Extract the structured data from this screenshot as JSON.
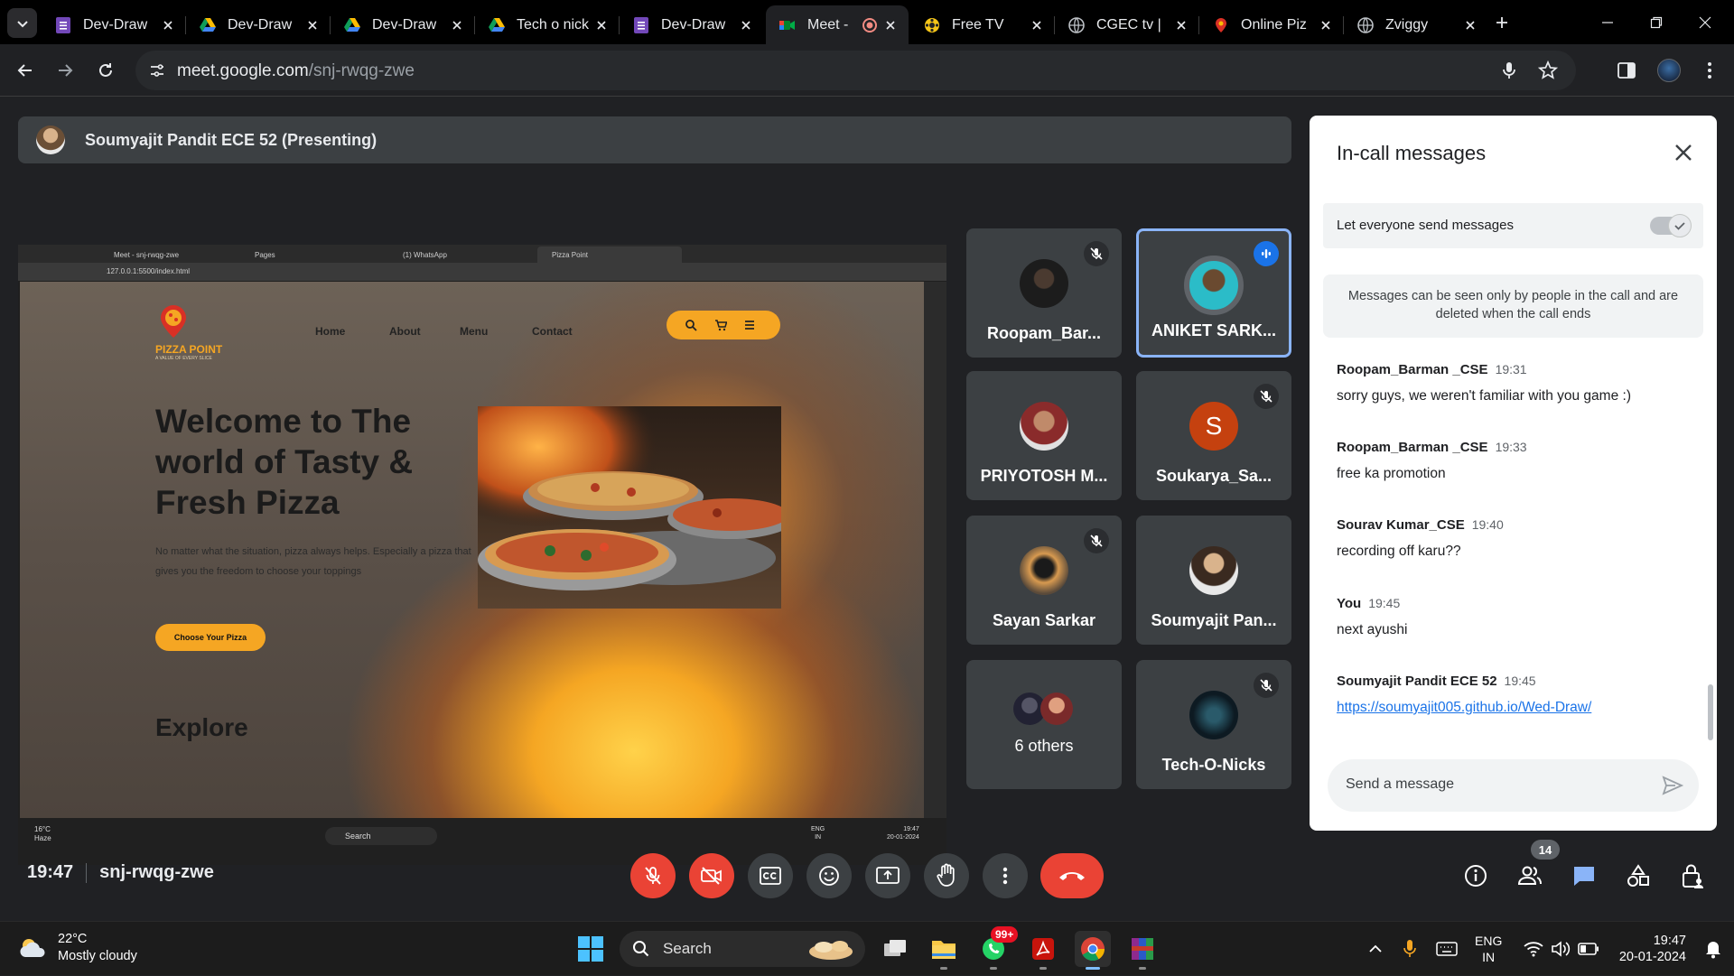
{
  "browser": {
    "tabs": [
      {
        "title": "Dev-Draw",
        "icon": "forms-icon",
        "active": false
      },
      {
        "title": "Dev-Draw",
        "icon": "drive-icon",
        "active": false
      },
      {
        "title": "Dev-Draw",
        "icon": "drive-icon",
        "active": false
      },
      {
        "title": "Tech o nick",
        "icon": "drive-icon",
        "active": false
      },
      {
        "title": "Dev-Draw",
        "icon": "forms-icon",
        "active": false
      },
      {
        "title": "Meet -",
        "icon": "meet-icon",
        "active": true
      },
      {
        "title": "Free TV",
        "icon": "tv-icon",
        "active": false
      },
      {
        "title": "CGEC tv |",
        "icon": "globe-icon",
        "active": false
      },
      {
        "title": "Online Piz",
        "icon": "pizza-icon",
        "active": false
      },
      {
        "title": "Zviggy",
        "icon": "globe-icon",
        "active": false
      }
    ],
    "url_domain": "meet.google.com",
    "url_path": "/snj-rwqg-zwe"
  },
  "presenter_bar": {
    "name": "Soumyajit Pandit ECE 52 (Presenting)"
  },
  "shared_screen": {
    "tabs": [
      "Meet - snj-rwqg-zwe",
      "Pages",
      "(1) WhatsApp",
      "Pizza Point"
    ],
    "url": "127.0.0.1:5500/index.html",
    "site": {
      "logo_text": "PIZZA POINT",
      "logo_tagline": "A VALUE OF EVERY SLICE",
      "nav": [
        "Home",
        "About",
        "Menu",
        "Contact"
      ],
      "headline": "Welcome to The world of Tasty & Fresh Pizza",
      "body": "No matter what the situation, pizza always helps. Especially a pizza that gives you the freedom to choose your toppings",
      "cta": "Choose Your Pizza",
      "next_section": "Explore"
    },
    "taskbar": {
      "temp": "16°C",
      "weather": "Haze",
      "search": "Search",
      "lang1": "ENG",
      "lang2": "IN",
      "time": "19:47",
      "date": "20-01-2024"
    }
  },
  "participants": [
    {
      "name": "Roopam_Bar...",
      "muted": true,
      "speaking": false,
      "avatar": "photo"
    },
    {
      "name": "ANIKET SARK...",
      "muted": false,
      "speaking": true,
      "avatar": "photo"
    },
    {
      "name": "PRIYOTOSH M...",
      "muted": false,
      "speaking": false,
      "avatar": "photo"
    },
    {
      "name": "Soukarya_Sa...",
      "muted": true,
      "speaking": false,
      "avatar": "letter",
      "letter": "S"
    },
    {
      "name": "Sayan Sarkar",
      "muted": true,
      "speaking": false,
      "avatar": "photo"
    },
    {
      "name": "Soumyajit Pan...",
      "muted": false,
      "speaking": false,
      "avatar": "photo"
    },
    {
      "name": "6 others",
      "muted": false,
      "speaking": false,
      "avatar": "group"
    },
    {
      "name": "Tech-O-Nicks",
      "muted": true,
      "speaking": false,
      "avatar": "photo"
    }
  ],
  "chat": {
    "title": "In-call messages",
    "option_label": "Let everyone send messages",
    "option_enabled": true,
    "notice": "Messages can be seen only by people in the call and are deleted when the call ends",
    "messages": [
      {
        "sender": "Roopam_Barman _CSE",
        "time": "19:31",
        "text": "sorry guys, we weren't familiar with you game :)"
      },
      {
        "sender": "Roopam_Barman _CSE",
        "time": "19:33",
        "text": "free ka promotion"
      },
      {
        "sender": "Sourav Kumar_CSE",
        "time": "19:40",
        "text": "recording off karu??"
      },
      {
        "sender": "You",
        "time": "19:45",
        "text": "next ayushi"
      },
      {
        "sender": "Soumyajit Pandit ECE 52",
        "time": "19:45",
        "link": "https://soumyajit005.github.io/Wed-Draw/"
      }
    ],
    "input_placeholder": "Send a message"
  },
  "meeting": {
    "time": "19:47",
    "code": "snj-rwqg-zwe",
    "people_count": "14"
  },
  "taskbar": {
    "temp": "22°C",
    "weather": "Mostly cloudy",
    "search": "Search",
    "notif_badge": "99+",
    "lang1": "ENG",
    "lang2": "IN",
    "time": "19:47",
    "date": "20-01-2024"
  },
  "colors": {
    "meet_bg": "#202124",
    "tile_bg": "#3c4043",
    "red": "#ea4335",
    "accent_blue": "#8ab4f8",
    "link": "#1a73e8",
    "pizza_orange": "#f5a623"
  }
}
